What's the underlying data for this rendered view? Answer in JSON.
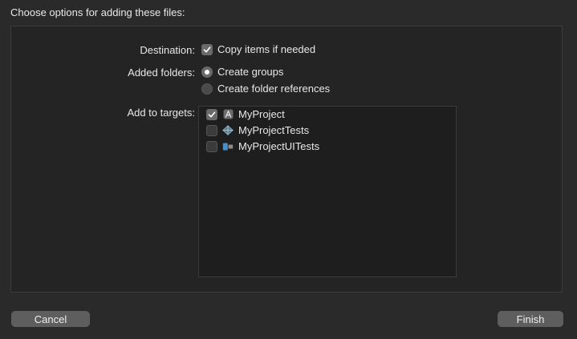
{
  "dialog": {
    "title": "Choose options for adding these files:"
  },
  "destination": {
    "label": "Destination:",
    "option": {
      "label": "Copy items if needed",
      "checked": true
    }
  },
  "added_folders": {
    "label": "Added folders:",
    "options": [
      {
        "label": "Create groups",
        "selected": true
      },
      {
        "label": "Create folder references",
        "selected": false
      }
    ]
  },
  "targets": {
    "label": "Add to targets:",
    "items": [
      {
        "name": "MyProject",
        "checked": true,
        "icon": "app-icon"
      },
      {
        "name": "MyProjectTests",
        "checked": false,
        "icon": "test-bundle-icon"
      },
      {
        "name": "MyProjectUITests",
        "checked": false,
        "icon": "ui-test-icon"
      }
    ]
  },
  "buttons": {
    "cancel": "Cancel",
    "finish": "Finish"
  }
}
